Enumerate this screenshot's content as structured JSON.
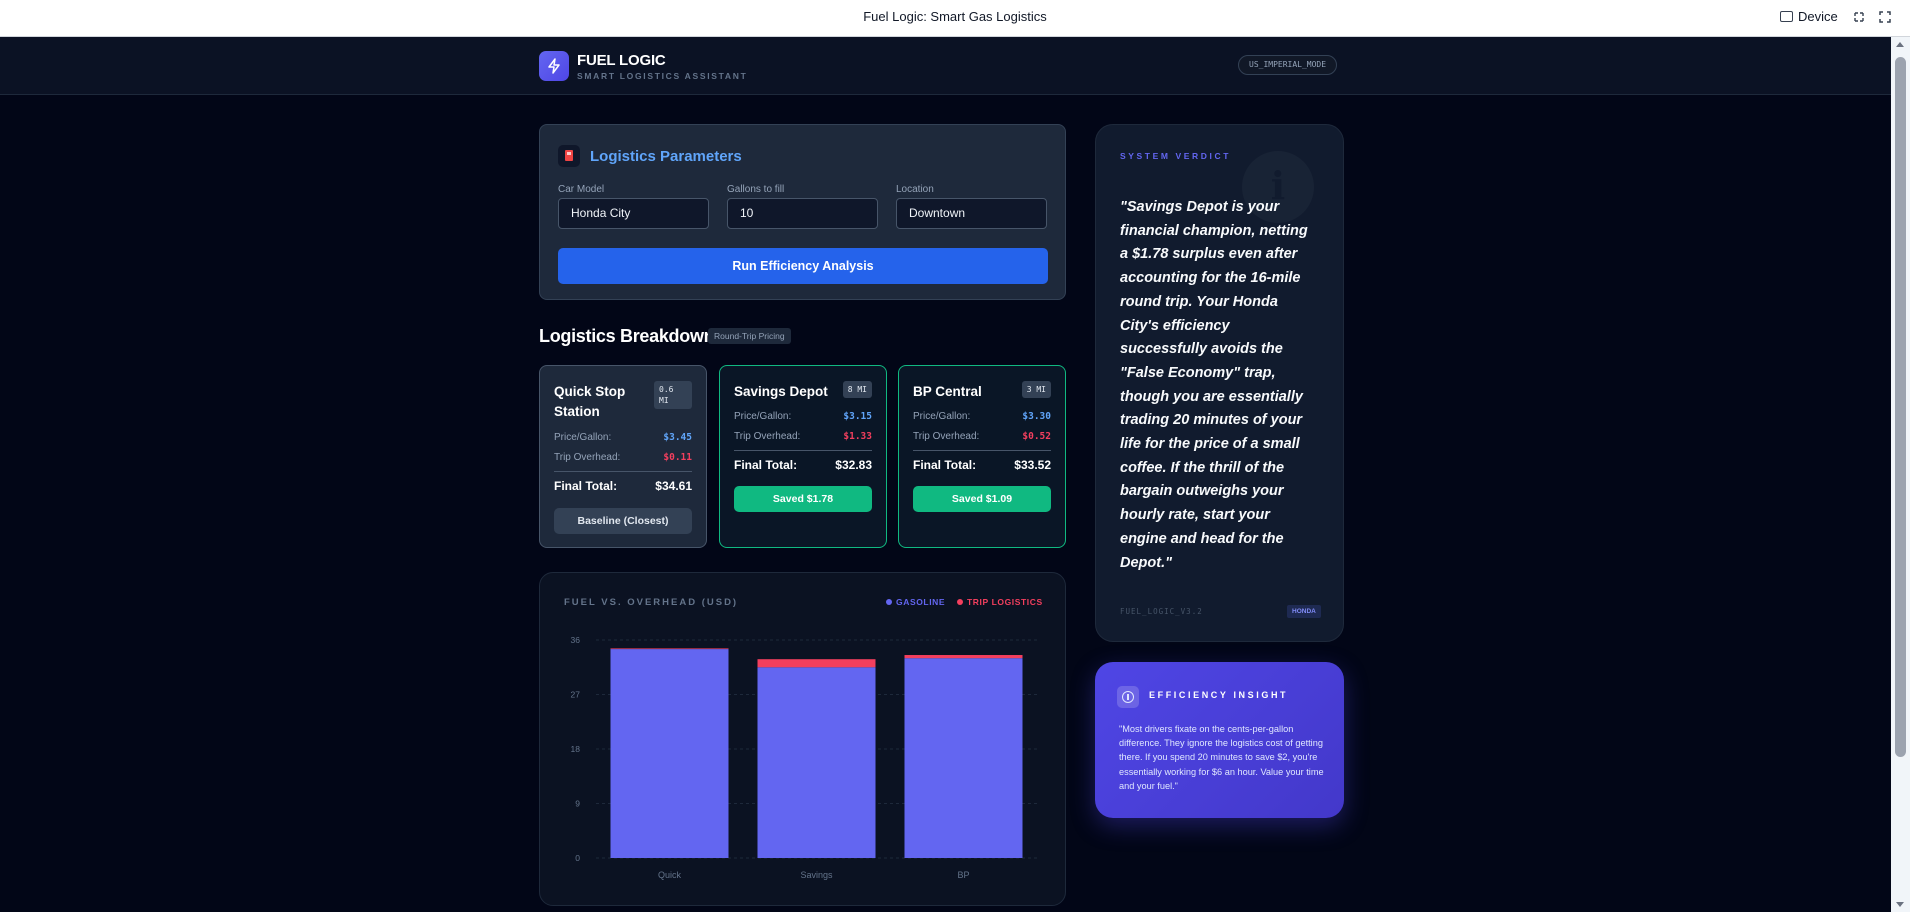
{
  "browser": {
    "title": "Fuel Logic: Smart Gas Logistics",
    "device_label": "Device"
  },
  "header": {
    "brand": "FUEL LOGIC",
    "subtitle": "SMART LOGISTICS ASSISTANT",
    "mode_badge": "US_IMPERIAL_MODE"
  },
  "parameters": {
    "title": "Logistics Parameters",
    "fields": [
      {
        "label": "Car Model",
        "value": "Honda City"
      },
      {
        "label": "Gallons to fill",
        "value": "10"
      },
      {
        "label": "Location",
        "value": "Downtown"
      }
    ],
    "run_button": "Run Efficiency Analysis"
  },
  "breakdown": {
    "title": "Logistics Breakdown",
    "badge": "Round-Trip Pricing",
    "price_label": "Price/Gallon:",
    "overhead_label": "Trip Overhead:",
    "total_label": "Final Total:",
    "stations": [
      {
        "name": "Quick Stop Station",
        "distance": "0.6 MI",
        "price": "$3.45",
        "overhead": "$0.11",
        "total": "$34.61",
        "button": "Baseline (Closest)"
      },
      {
        "name": "Savings Depot",
        "distance": "8 MI",
        "price": "$3.15",
        "overhead": "$1.33",
        "total": "$32.83",
        "button": "Saved $1.78"
      },
      {
        "name": "BP Central",
        "distance": "3 MI",
        "price": "$3.30",
        "overhead": "$0.52",
        "total": "$33.52",
        "button": "Saved $1.09"
      }
    ]
  },
  "chart_data": {
    "type": "bar",
    "title": "FUEL VS. OVERHEAD (USD)",
    "categories": [
      "Quick",
      "Savings",
      "BP"
    ],
    "series": [
      {
        "name": "GASOLINE",
        "values": [
          34.5,
          31.5,
          33.0
        ],
        "color": "#6366f1"
      },
      {
        "name": "TRIP LOGISTICS",
        "values": [
          0.11,
          1.33,
          0.52
        ],
        "color": "#f43f5e"
      }
    ],
    "yticks": [
      "0",
      "9",
      "18",
      "27",
      "36"
    ],
    "ylim": [
      0,
      36
    ],
    "stacked": true,
    "grid": true,
    "legend": "top-right"
  },
  "verdict": {
    "label": "SYSTEM VERDICT",
    "quote": "\"Savings Depot is your financial champion, netting a $1.78 surplus even after accounting for the 16-mile round trip. Your Honda City's efficiency successfully avoids the \"False Economy\" trap, though you are essentially trading 20 minutes of your life for the price of a small coffee. If the thrill of the bargain outweighs your hourly rate, start your engine and head for the Depot.\"",
    "version": "FUEL_LOGIC_V3.2",
    "tag": "HONDA"
  },
  "insight": {
    "title": "EFFICIENCY INSIGHT",
    "body": "\"Most drivers fixate on the cents-per-gallon difference. They ignore the logistics cost of getting there. If you spend 20 minutes to save $2, you're essentially working for $6 an hour. Value your time and your fuel.\""
  }
}
